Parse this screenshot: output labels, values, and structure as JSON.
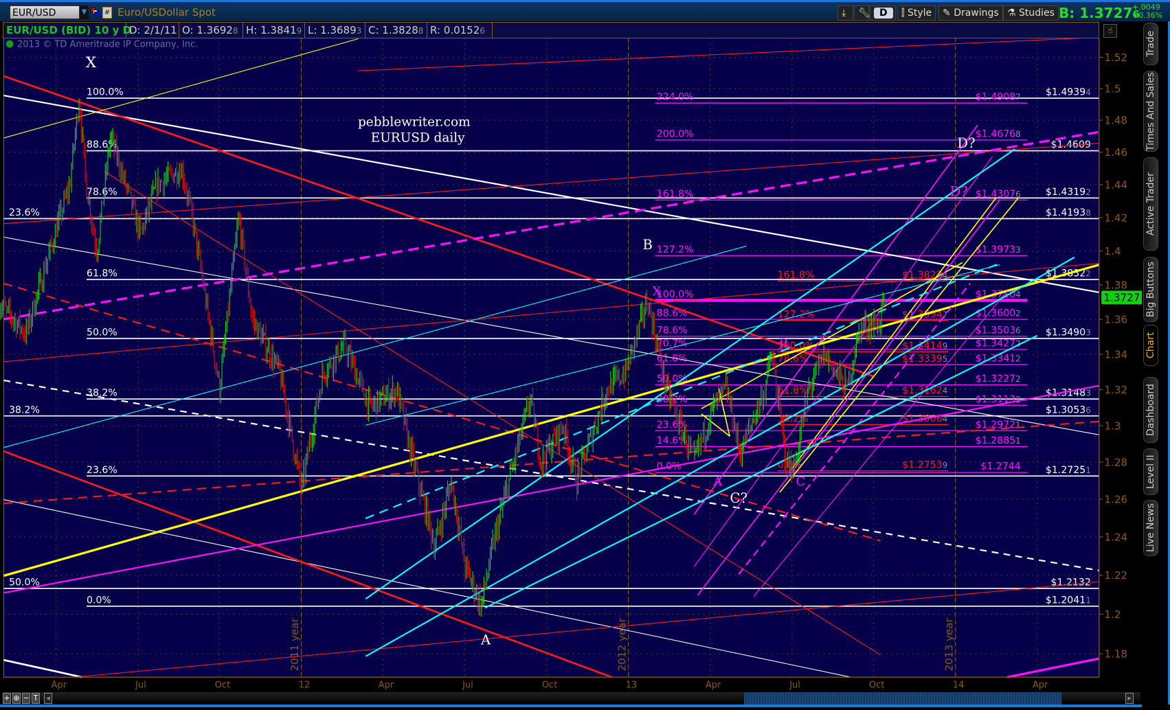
{
  "header": {
    "symbol": "EUR/USD",
    "description": "Euro/USDollar Spot",
    "hash_label": "#",
    "period_button": "D",
    "style_label": "Style",
    "drawings_label": "Drawings",
    "studies_label": "Studies",
    "bid": "B: 1.3727",
    "bid_sub": "6",
    "change": "+.0049",
    "change_pct": "+0.36%"
  },
  "infobar": {
    "title": "EUR/USD (BID) 10 y D",
    "date": "D: 2/1/11",
    "open": "O: 1.3692",
    "open_sub": "8",
    "high": "H: 1.3841",
    "high_sub": "9",
    "low": "L: 1.3689",
    "low_sub": "3",
    "close": "C: 1.3828",
    "close_sub": "8",
    "range": "R: 0.0152",
    "range_sub": "6"
  },
  "copyright": "2013 © TD Ameritrade IP Company, Inc.",
  "watermark": {
    "line1": "pebblewriter.com",
    "line2": "EURUSD daily"
  },
  "sidebar": {
    "tabs": [
      "Trade",
      "Times And Sales",
      "Active Trader",
      "Big Buttons",
      "Chart",
      "Dashboard",
      "Level II",
      "Live News"
    ],
    "active": "Chart"
  },
  "scroll": {
    "zoom_in": "+",
    "zoom_fit": "⊕",
    "zoom_out": "−",
    "text_tool": "T"
  },
  "colors": {
    "bg": "#06004a",
    "up": "#22d022",
    "down": "#e01010",
    "axis": "#8a5a10",
    "white": "#ffffff",
    "magenta": "#ff10ff",
    "red": "#ff1a1a",
    "yellow": "#ffff00",
    "cyan": "#00ffff"
  },
  "chart_data": {
    "type": "candlestick",
    "title": "EUR/USD (BID) 10 y D",
    "yscale": "log",
    "ylim": [
      1.17,
      1.53
    ],
    "yticks": [
      "1.18",
      "1.2",
      "1.22",
      "1.24",
      "1.26",
      "1.28",
      "1.3",
      "1.32",
      "1.34",
      "1.36",
      "1.38",
      "1.4",
      "1.42",
      "1.44",
      "1.46",
      "1.48",
      "1.5",
      "1.52"
    ],
    "xticks": [
      {
        "label": "Apr",
        "t": 3
      },
      {
        "label": "Jul",
        "t": 6
      },
      {
        "label": "Oct",
        "t": 9
      },
      {
        "label": "12",
        "t": 12
      },
      {
        "label": "Apr",
        "t": 15
      },
      {
        "label": "Jul",
        "t": 18
      },
      {
        "label": "Oct",
        "t": 21
      },
      {
        "label": "13",
        "t": 24
      },
      {
        "label": "Apr",
        "t": 27
      },
      {
        "label": "Jul",
        "t": 30
      },
      {
        "label": "Oct",
        "t": 33
      },
      {
        "label": "14",
        "t": 36
      },
      {
        "label": "Apr",
        "t": 39
      }
    ],
    "x_units": "months since Jan 2011",
    "year_markers": [
      {
        "label": "2011 year",
        "t": 12
      },
      {
        "label": "2012 year",
        "t": 24
      },
      {
        "label": "2013 year",
        "t": 36
      }
    ],
    "last_price": "1.3727",
    "last_price_sub": "7",
    "price_path": [
      [
        0.9,
        1.369
      ],
      [
        1.9,
        1.352
      ],
      [
        3.5,
        1.44
      ],
      [
        3.85,
        1.494
      ],
      [
        4.1,
        1.44
      ],
      [
        4.5,
        1.4
      ],
      [
        5.0,
        1.47
      ],
      [
        6.1,
        1.41
      ],
      [
        6.7,
        1.44
      ],
      [
        7.6,
        1.45
      ],
      [
        8.0,
        1.42
      ],
      [
        9.0,
        1.32
      ],
      [
        9.7,
        1.42
      ],
      [
        10.2,
        1.36
      ],
      [
        11.2,
        1.33
      ],
      [
        12.0,
        1.265
      ],
      [
        12.8,
        1.33
      ],
      [
        13.6,
        1.345
      ],
      [
        14.5,
        1.31
      ],
      [
        15.5,
        1.32
      ],
      [
        16.1,
        1.28
      ],
      [
        16.9,
        1.235
      ],
      [
        17.5,
        1.27
      ],
      [
        18.0,
        1.225
      ],
      [
        18.6,
        1.2045
      ],
      [
        19.1,
        1.24
      ],
      [
        20.4,
        1.315
      ],
      [
        20.8,
        1.28
      ],
      [
        21.6,
        1.3
      ],
      [
        22.1,
        1.27
      ],
      [
        23.2,
        1.32
      ],
      [
        23.9,
        1.33
      ],
      [
        24.7,
        1.371
      ],
      [
        25.4,
        1.32
      ],
      [
        26.4,
        1.28
      ],
      [
        27.1,
        1.31
      ],
      [
        27.6,
        1.32
      ],
      [
        28.1,
        1.285
      ],
      [
        29.0,
        1.32
      ],
      [
        29.25,
        1.34
      ],
      [
        29.8,
        1.28
      ],
      [
        30.1,
        1.277
      ],
      [
        30.6,
        1.32
      ],
      [
        31.2,
        1.34
      ],
      [
        32.0,
        1.32
      ],
      [
        32.5,
        1.355
      ],
      [
        33.2,
        1.358
      ],
      [
        33.4,
        1.3727
      ]
    ],
    "levels": {
      "xa_white": [
        {
          "pct": "100.0%",
          "price": 1.4939,
          "label": "$1.4939",
          "sub": "4"
        },
        {
          "pct": "88.6%",
          "price": 1.4609,
          "label": "$1.4609",
          "sub": ""
        },
        {
          "pct": "78.6%",
          "price": 1.4319,
          "label": "$1.4319",
          "sub": "2"
        },
        {
          "pct": "61.8%",
          "price": 1.3832,
          "label": "$1.3832",
          "sub": "2"
        },
        {
          "pct": "50.0%",
          "price": 1.349,
          "label": "$1.3490",
          "sub": "3"
        },
        {
          "pct": "38.2%",
          "price": 1.3148,
          "label": "$1.3148",
          "sub": "3"
        },
        {
          "pct": "23.6%",
          "price": 1.2725,
          "label": "$1.2725",
          "sub": "1"
        },
        {
          "pct": "0.0%",
          "price": 1.2041,
          "label": "$1.2041",
          "sub": "1"
        }
      ],
      "outer_white": [
        {
          "pct": "23.6%",
          "price": 1.4194,
          "label": "$1.4193",
          "sub": "8"
        },
        {
          "pct": "38.2%",
          "price": 1.3054,
          "label": "$1.3053",
          "sub": "6"
        },
        {
          "pct": "50.0%",
          "price": 1.2132,
          "label": "$1.2132",
          "sub": ""
        }
      ],
      "magenta": [
        {
          "pct": "224.0%",
          "price": 1.4908,
          "label": "$1.4908",
          "sub": "7"
        },
        {
          "pct": "200.0%",
          "price": 1.4676,
          "label": "$1.4676",
          "sub": "8"
        },
        {
          "pct": "161.8%",
          "price": 1.4307,
          "label": "$1.4307",
          "sub": "6"
        },
        {
          "pct": "127.2%",
          "price": 1.3973,
          "label": "$1.3973",
          "sub": "3"
        },
        {
          "pct": "100.0%",
          "price": 1.371,
          "label": "$1.3710",
          "sub": "4"
        },
        {
          "pct": "88.6%",
          "price": 1.36,
          "label": "$1.3600",
          "sub": "2"
        },
        {
          "pct": "78.6%",
          "price": 1.3503,
          "label": "$1.3503",
          "sub": "6"
        },
        {
          "pct": "70.7%",
          "price": 1.3427,
          "label": "$1.3427",
          "sub": "2"
        },
        {
          "pct": "61.8%",
          "price": 1.3341,
          "label": "$1.3341",
          "sub": "2"
        },
        {
          "pct": "50.0%",
          "price": 1.3227,
          "label": "$1.3227",
          "sub": "2"
        },
        {
          "pct": "38.2%",
          "price": 1.3113,
          "label": "$1.3113",
          "sub": "2"
        },
        {
          "pct": "23.6%",
          "price": 1.2972,
          "label": "$1.2972",
          "sub": "1"
        },
        {
          "pct": "14.6%",
          "price": 1.2885,
          "label": "$1.2885",
          "sub": "1"
        },
        {
          "pct": "0.0%",
          "price": 1.2744,
          "label": "$1.2744",
          "sub": ""
        }
      ],
      "red": [
        {
          "pct": "161.8%",
          "price": 1.3823,
          "label": "$1.3823",
          "sub": "4"
        },
        {
          "pct": "127.2%",
          "price": 1.3594,
          "label": "$1.3594",
          "sub": "7"
        },
        {
          "pct": "100.0%",
          "price": 1.3414,
          "label": "$1.3414",
          "sub": "9"
        },
        {
          "pct": "78.6%",
          "price": 1.3339,
          "label": "$1.3339",
          "sub": "5"
        },
        {
          "pct": "61.8%",
          "price": 1.3162,
          "label": "$1.3162",
          "sub": "4"
        },
        {
          "pct": "38.2%",
          "price": 1.3006,
          "label": "$1.3006",
          "sub": "4"
        },
        {
          "pct": "0.0%",
          "price": 1.2753,
          "label": "$1.2753",
          "sub": "9"
        }
      ]
    },
    "wave_labels": [
      {
        "text": "X",
        "color": "white"
      },
      {
        "text": "B",
        "color": "white"
      },
      {
        "text": "A",
        "color": "white"
      },
      {
        "text": "D?",
        "color": "white"
      },
      {
        "text": "D?",
        "color": "magenta"
      },
      {
        "text": "X",
        "color": "magenta"
      },
      {
        "text": "A",
        "color": "magenta"
      },
      {
        "text": "C?",
        "color": "white"
      },
      {
        "text": "C",
        "color": "magenta"
      },
      {
        "text": "B",
        "color": "magenta"
      }
    ]
  }
}
